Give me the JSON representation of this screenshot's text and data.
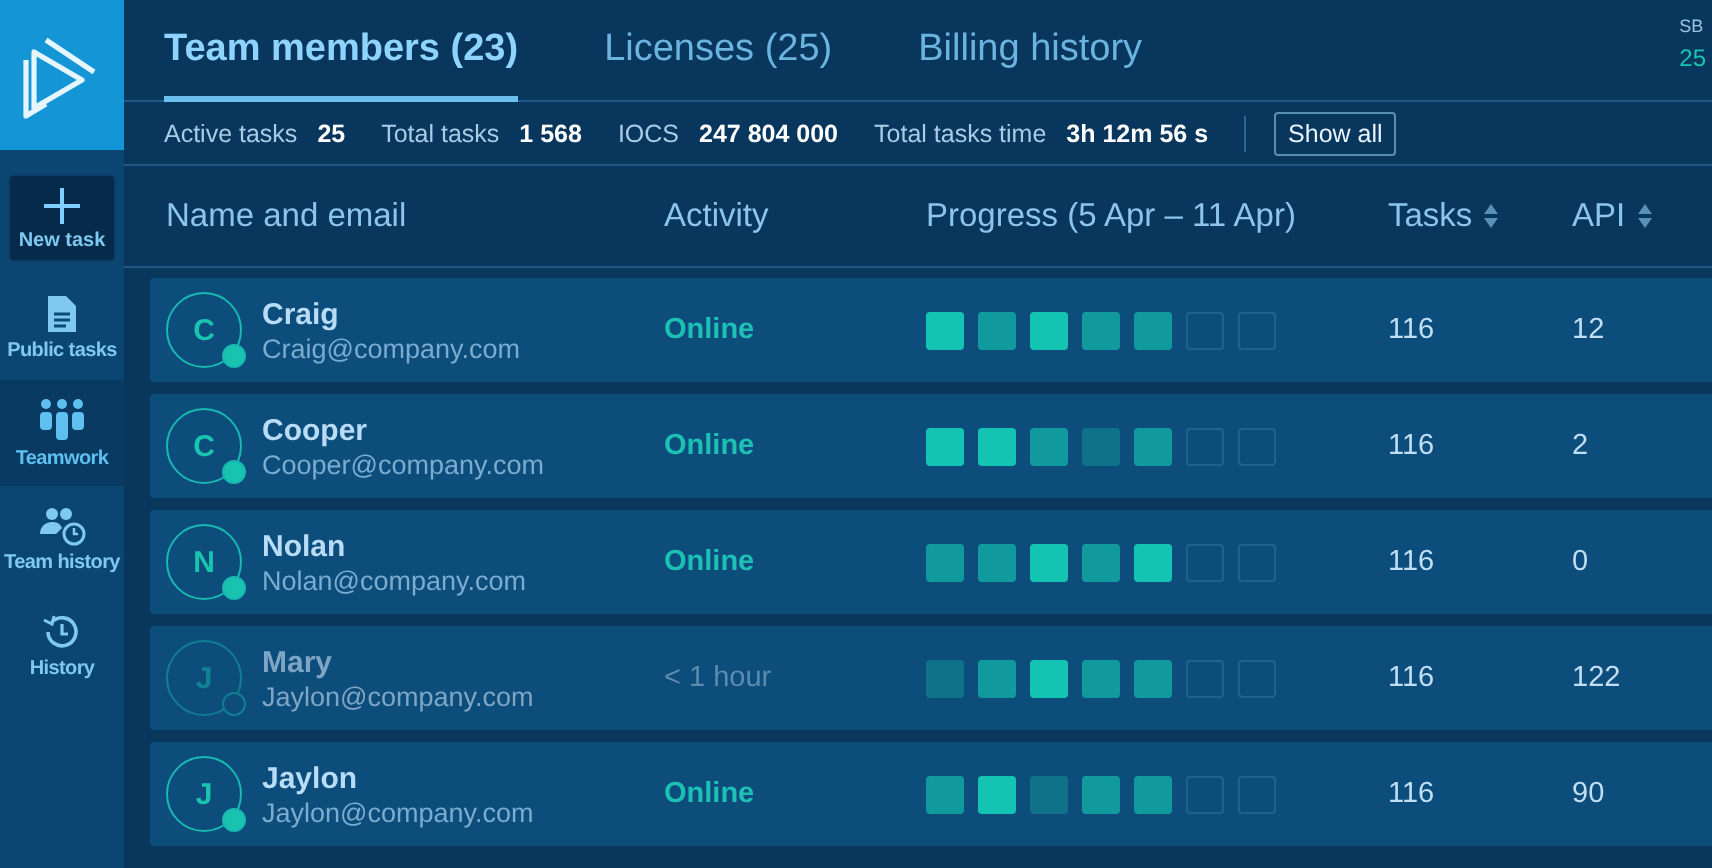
{
  "sidebar": {
    "new_task": "New task",
    "items": [
      {
        "label": "Public tasks",
        "selected": false
      },
      {
        "label": "Teamwork",
        "selected": true
      },
      {
        "label": "Team history",
        "selected": false
      },
      {
        "label": "History",
        "selected": false
      }
    ]
  },
  "tabs": [
    {
      "label": "Team members (23)",
      "selected": true
    },
    {
      "label": "Licenses (25)",
      "selected": false
    },
    {
      "label": "Billing history",
      "selected": false
    }
  ],
  "corner": {
    "label": "SB",
    "value": "25"
  },
  "stats": [
    {
      "label": "Active tasks",
      "value": "25"
    },
    {
      "label": "Total tasks",
      "value": "1 568"
    },
    {
      "label": "IOCS",
      "value": "247 804 000"
    },
    {
      "label": "Total tasks time",
      "value": "3h 12m 56 s"
    }
  ],
  "show_all": "Show all",
  "columns": [
    {
      "label": "Name and email",
      "sortable": false
    },
    {
      "label": "Activity",
      "sortable": false
    },
    {
      "label": "Progress (5 Apr – 11 Apr)",
      "sortable": false
    },
    {
      "label": "Tasks",
      "sortable": true
    },
    {
      "label": "API",
      "sortable": true
    }
  ],
  "rows": [
    {
      "initial": "C",
      "name": "Craig",
      "email": "Craig@company.com",
      "online": true,
      "activity": "Online",
      "progress": [
        {
          "kind": "high"
        },
        {
          "kind": "medium"
        },
        {
          "kind": "high"
        },
        {
          "kind": "medium"
        },
        {
          "kind": "medium"
        },
        {
          "kind": "empty"
        },
        {
          "kind": "empty"
        }
      ],
      "tasks": "116",
      "api": "12"
    },
    {
      "initial": "C",
      "name": "Cooper",
      "email": "Cooper@company.com",
      "online": true,
      "activity": "Online",
      "progress": [
        {
          "kind": "high"
        },
        {
          "kind": "high"
        },
        {
          "kind": "medium"
        },
        {
          "kind": "low"
        },
        {
          "kind": "medium"
        },
        {
          "kind": "empty"
        },
        {
          "kind": "empty"
        }
      ],
      "tasks": "116",
      "api": "2"
    },
    {
      "initial": "N",
      "name": "Nolan",
      "email": "Nolan@company.com",
      "online": true,
      "activity": "Online",
      "progress": [
        {
          "kind": "medium"
        },
        {
          "kind": "medium"
        },
        {
          "kind": "high"
        },
        {
          "kind": "medium"
        },
        {
          "kind": "high"
        },
        {
          "kind": "empty"
        },
        {
          "kind": "empty"
        }
      ],
      "tasks": "116",
      "api": "0"
    },
    {
      "initial": "J",
      "name": "Mary",
      "email": "Jaylon@company.com",
      "online": false,
      "activity": "< 1 hour",
      "progress": [
        {
          "kind": "low"
        },
        {
          "kind": "medium"
        },
        {
          "kind": "high"
        },
        {
          "kind": "medium"
        },
        {
          "kind": "medium"
        },
        {
          "kind": "empty"
        },
        {
          "kind": "empty"
        }
      ],
      "tasks": "116",
      "api": "122"
    },
    {
      "initial": "J",
      "name": "Jaylon",
      "email": "Jaylon@company.com",
      "online": true,
      "activity": "Online",
      "progress": [
        {
          "kind": "medium"
        },
        {
          "kind": "high"
        },
        {
          "kind": "low"
        },
        {
          "kind": "medium"
        },
        {
          "kind": "medium"
        },
        {
          "kind": "empty"
        },
        {
          "kind": "empty"
        }
      ],
      "tasks": "116",
      "api": "90"
    }
  ]
}
